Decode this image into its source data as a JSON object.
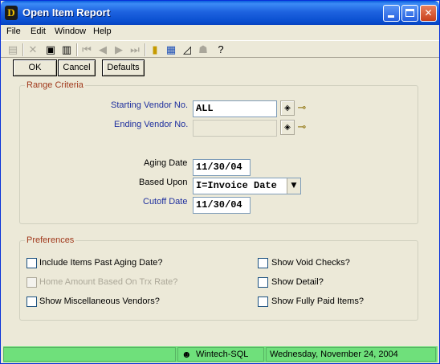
{
  "window": {
    "title": "Open Item Report"
  },
  "menu": [
    "File",
    "Edit",
    "Window",
    "Help"
  ],
  "toolbar": {
    "icons": [
      "new-icon",
      "delete-icon",
      "save-icon",
      "trash-icon",
      "first-record-icon",
      "prev-record-icon",
      "next-record-icon",
      "last-record-icon",
      "notes-icon",
      "calculator-icon",
      "chart-icon",
      "people-icon",
      "help-pointer-icon"
    ]
  },
  "buttons": {
    "ok": "OK",
    "cancel": "Cancel",
    "defaults": "Defaults"
  },
  "range": {
    "title": "Range Criteria",
    "starting_vendor_label": "Starting Vendor No.",
    "starting_vendor_value": "ALL",
    "ending_vendor_label": "Ending Vendor No.",
    "ending_vendor_value": "",
    "aging_date_label": "Aging Date",
    "aging_date_value": "11/30/04",
    "based_upon_label": "Based Upon",
    "based_upon_value": "I=Invoice Date",
    "cutoff_date_label": "Cutoff Date",
    "cutoff_date_value": "11/30/04"
  },
  "preferences": {
    "title": "Preferences",
    "include_past_aging": "Include Items Past Aging Date?",
    "home_amount": "Home Amount Based On Trx Rate?",
    "show_misc_vendors": "Show Miscellaneous Vendors?",
    "show_void_checks": "Show Void Checks?",
    "show_detail": "Show Detail?",
    "show_fully_paid": "Show Fully Paid Items?"
  },
  "status": {
    "server": "Wintech-SQL",
    "date": "Wednesday, November 24, 2004"
  },
  "colors": {
    "group_title": "#a0391c",
    "field_label": "#1e2f9e",
    "status_bar": "#6fe07b"
  }
}
